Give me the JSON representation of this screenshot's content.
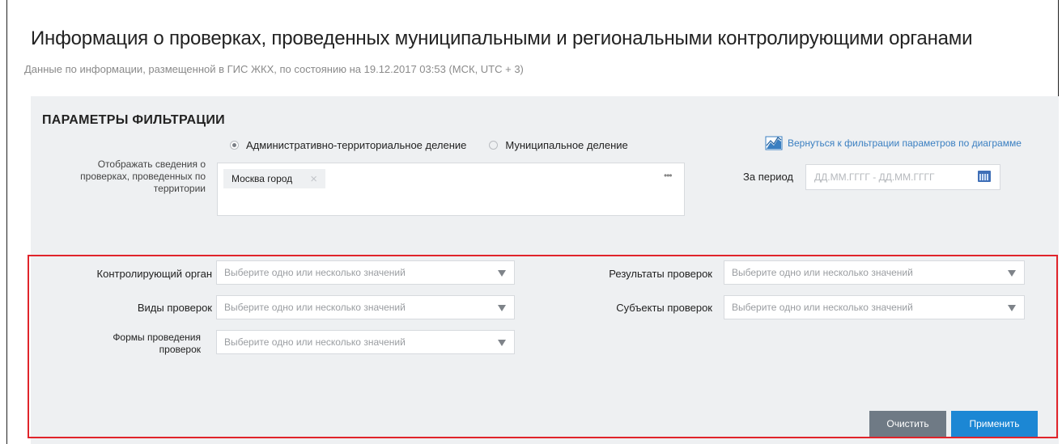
{
  "page": {
    "title": "Информация о проверках, проведенных муниципальными и региональными контролирующими органами",
    "subtitle": "Данные по информации, размещенной в ГИС ЖКХ, по состоянию на 19.12.2017 03:53 (МСК, UTC + 3)"
  },
  "filters": {
    "heading": "ПАРАМЕТРЫ ФИЛЬТРАЦИИ",
    "back_link": "Вернуться к фильтрации параметров по диаграмме",
    "radio_admin": "Административно-территориальное деление",
    "radio_municipal": "Муниципальное деление",
    "radio_selected": "admin",
    "territory_label": "Отображать сведения о проверках, проведенных по территории",
    "territory_chip": "Москва город",
    "more_dots": "•••",
    "period_label": "За период",
    "period_placeholder": "ДД.ММ.ГГГГ - ДД.ММ.ГГГГ",
    "select_placeholder": "Выберите одно или несколько значений",
    "control_organ_label": "Контролирующий орган",
    "inspection_types_label": "Виды проверок",
    "inspection_forms_label": "Формы проведения проверок",
    "results_label": "Результаты проверок",
    "subjects_label": "Субъекты проверок",
    "clear_button": "Очистить",
    "apply_button": "Применить"
  },
  "colors": {
    "accent_blue": "#1c87d4",
    "clear_gray": "#6f7a85",
    "highlight_red": "#e0242b",
    "panel_bg": "#eef0f2"
  }
}
